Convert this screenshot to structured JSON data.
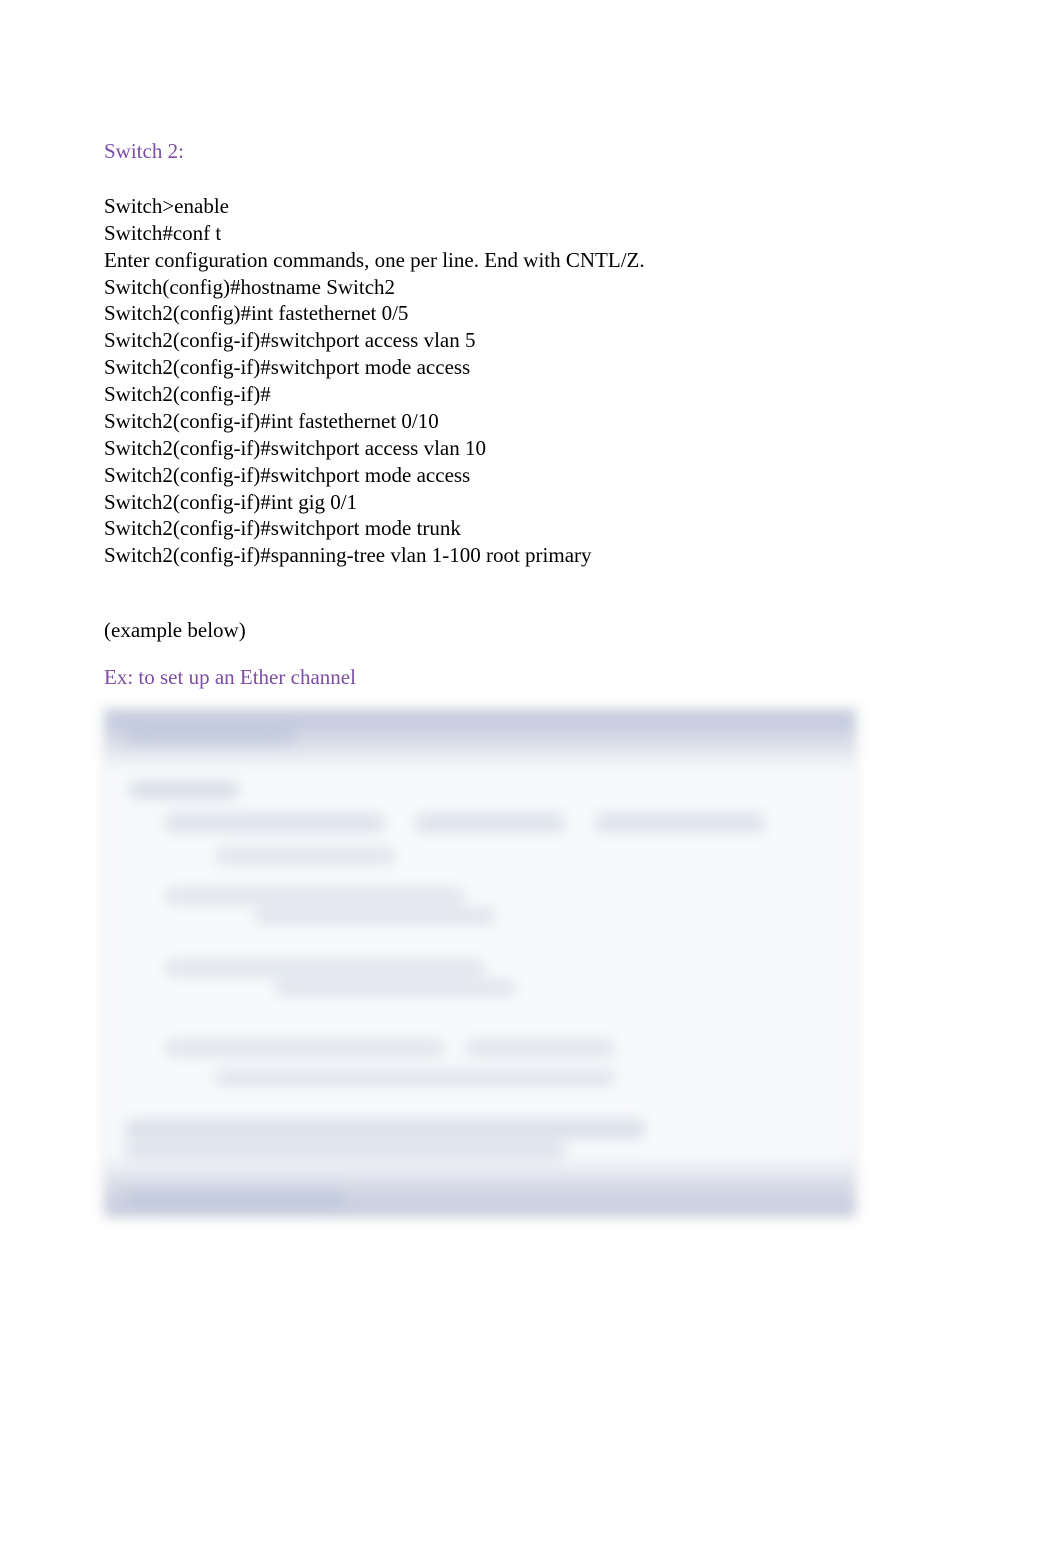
{
  "heading1": "Switch 2:",
  "cli": [
    "Switch>enable",
    "Switch#conf t",
    "Enter configuration commands, one per line. End with CNTL/Z.",
    "Switch(config)#hostname Switch2",
    "Switch2(config)#int fastethernet 0/5",
    "Switch2(config-if)#switchport access vlan 5",
    "Switch2(config-if)#switchport mode access",
    "Switch2(config-if)#",
    "Switch2(config-if)#int fastethernet 0/10",
    "Switch2(config-if)#switchport access vlan 10",
    "Switch2(config-if)#switchport mode access",
    "Switch2(config-if)#int gig 0/1",
    "Switch2(config-if)#switchport mode trunk",
    "Switch2(config-if)#spanning-tree vlan 1-100 root primary"
  ],
  "note": "(example below)",
  "subheading": "Ex: to set up an Ether channel"
}
